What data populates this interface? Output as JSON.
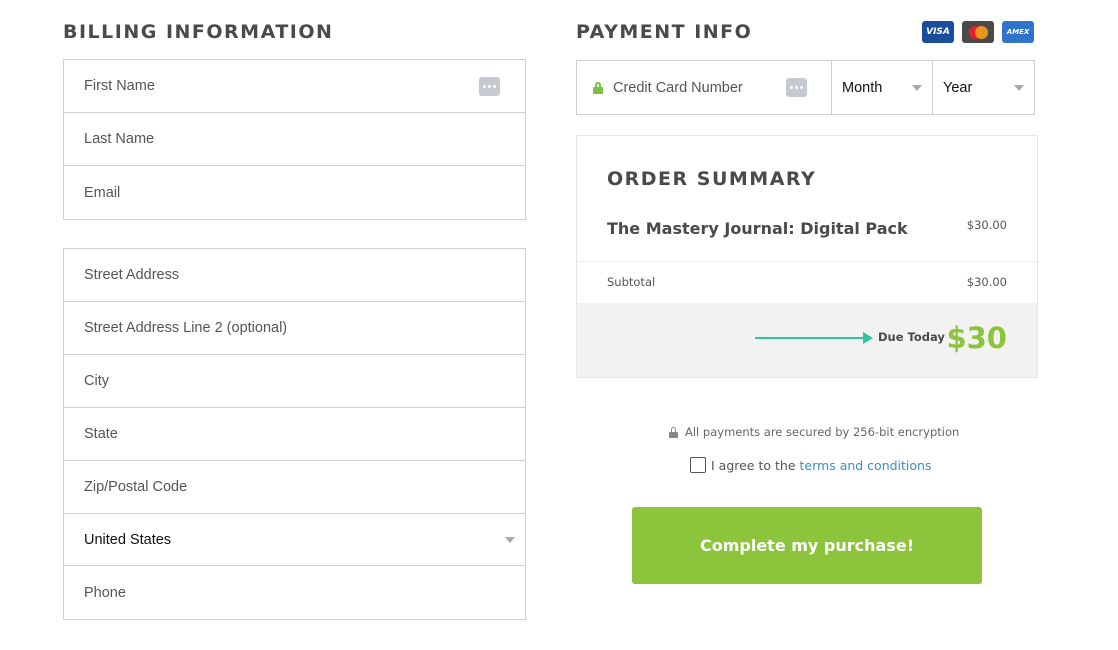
{
  "billing": {
    "heading": "BILLING INFORMATION",
    "personal_fields": [
      {
        "placeholder": "First Name"
      },
      {
        "placeholder": "Last Name"
      },
      {
        "placeholder": "Email"
      }
    ],
    "address_fields": {
      "street": "Street Address",
      "street2": "Street Address Line 2 (optional)",
      "city": "City",
      "state": "State",
      "zip": "Zip/Postal Code",
      "country_selected": "United States",
      "phone": "Phone"
    }
  },
  "payment": {
    "heading": "PAYMENT INFO",
    "card_logos": [
      {
        "name": "visa-logo",
        "text": "VISA"
      },
      {
        "name": "mastercard-logo",
        "text": ""
      },
      {
        "name": "amex-logo",
        "text": "AMEX"
      }
    ],
    "card_number_placeholder": "Credit Card Number",
    "month_selected": "Month",
    "year_selected": "Year"
  },
  "order_summary": {
    "title": "ORDER SUMMARY",
    "product_name": "The Mastery Journal: Digital Pack",
    "product_price": "$30.00",
    "subtotal_label": "Subtotal",
    "subtotal_value": "$30.00",
    "due_label": "Due Today",
    "due_amount": "$30"
  },
  "security_note": "All payments are secured by 256-bit encryption",
  "agreement": {
    "prefix": "I agree to the",
    "link_text": "terms and conditions"
  },
  "cta_label": "Complete my purchase!",
  "colors": {
    "accent_green": "#8cc43c",
    "link_blue": "#3b8fc6",
    "arrow_teal": "#2ec4a0"
  }
}
